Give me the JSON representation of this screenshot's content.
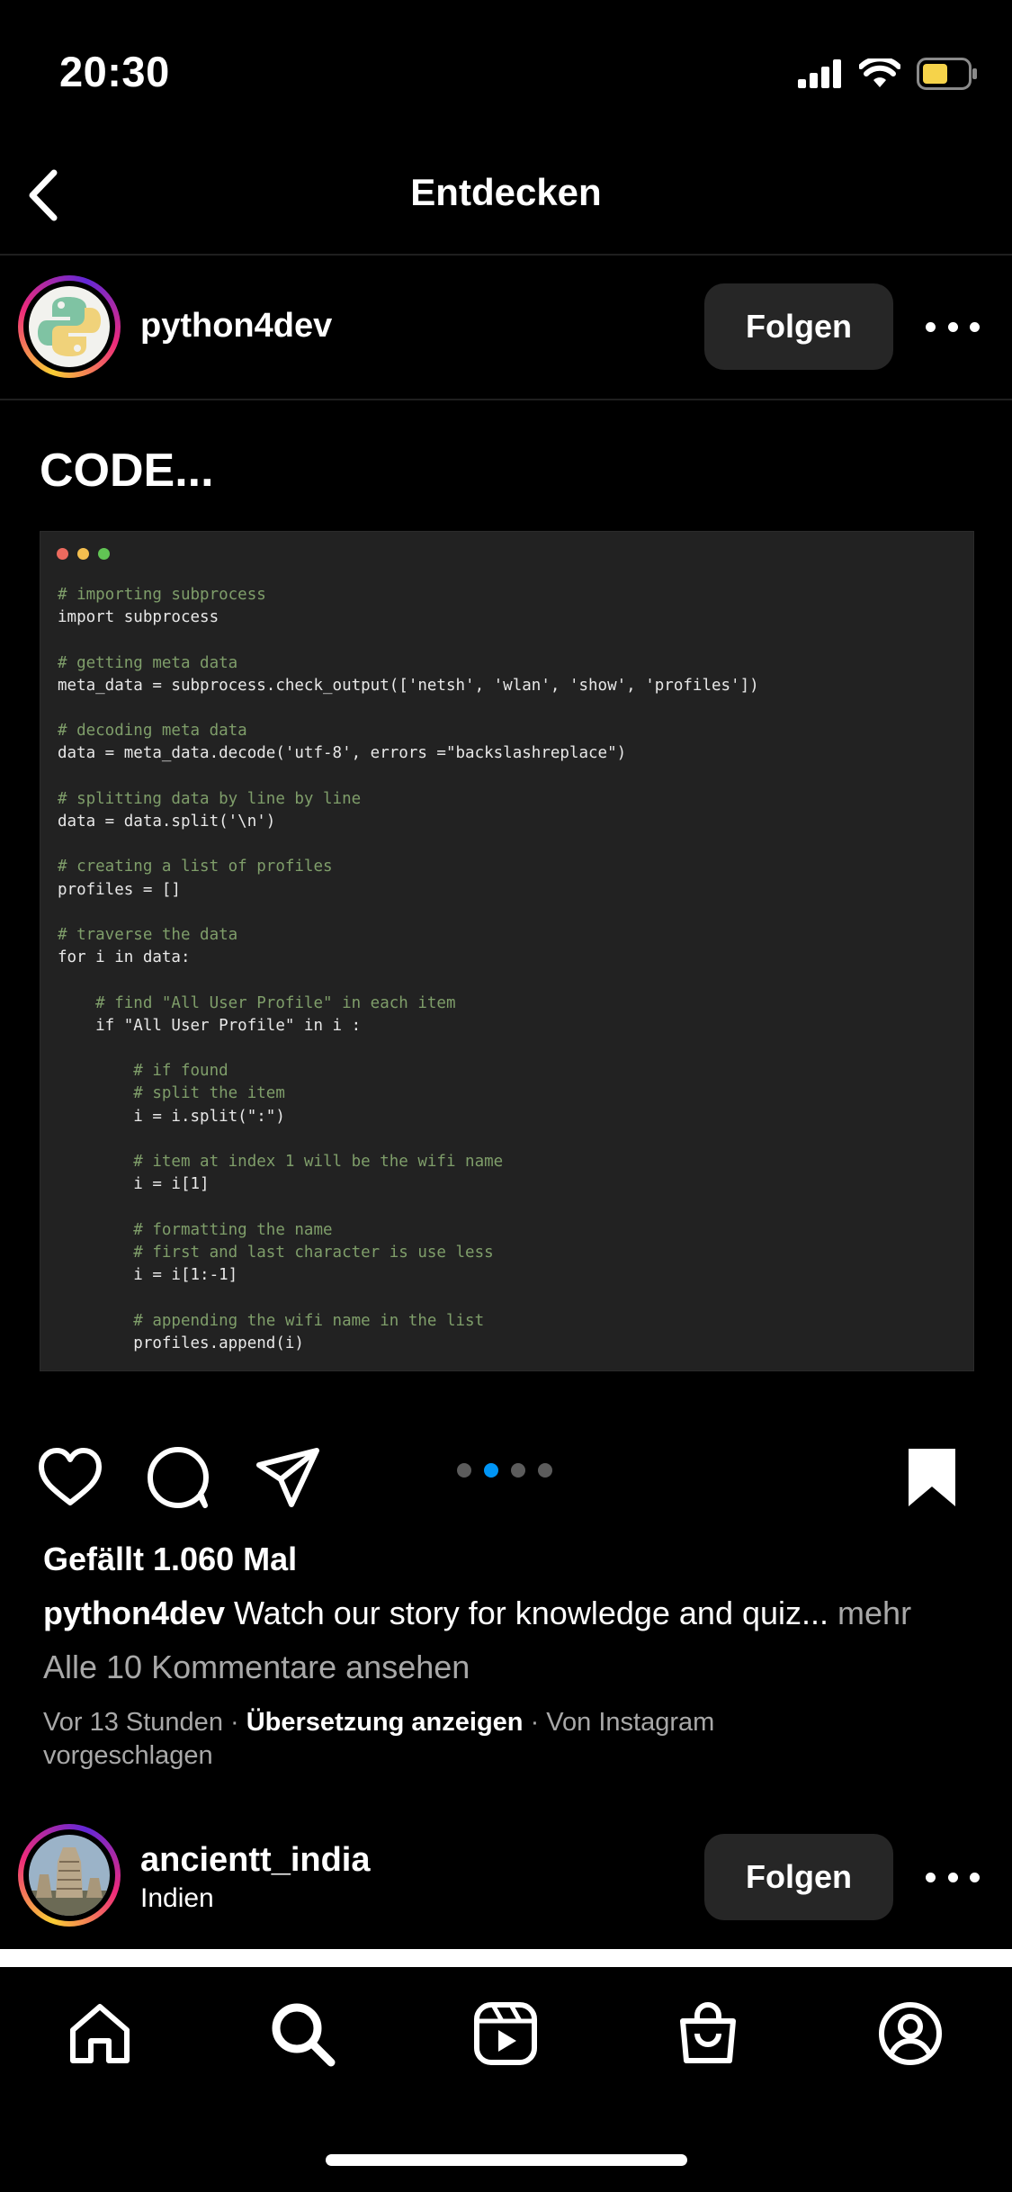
{
  "status_bar": {
    "time": "20:30"
  },
  "header": {
    "title": "Entdecken"
  },
  "post": {
    "username": "python4dev",
    "follow_label": "Folgen",
    "heading": "CODE...",
    "code_lines": [
      "# importing subprocess",
      "import subprocess",
      "",
      "# getting meta data",
      "meta_data = subprocess.check_output(['netsh', 'wlan', 'show', 'profiles'])",
      "",
      "# decoding meta data",
      "data = meta_data.decode('utf-8', errors =\"backslashreplace\")",
      "",
      "# splitting data by line by line",
      "data = data.split('\\n')",
      "",
      "# creating a list of profiles",
      "profiles = []",
      "",
      "# traverse the data",
      "for i in data:",
      "",
      "    # find \"All User Profile\" in each item",
      "    if \"All User Profile\" in i :",
      "",
      "        # if found",
      "        # split the item",
      "        i = i.split(\":\")",
      "",
      "        # item at index 1 will be the wifi name",
      "        i = i[1]",
      "",
      "        # formatting the name",
      "        # first and last character is use less",
      "        i = i[1:-1]",
      "",
      "        # appending the wifi name in the list",
      "        profiles.append(i)"
    ],
    "carousel": {
      "total": 4,
      "active_index": 1
    },
    "likes": "Gefällt 1.060 Mal",
    "caption_user": "python4dev",
    "caption_text": " Watch our story for knowledge and quiz...",
    "caption_more": " mehr",
    "comments_link": "Alle 10 Kommentare ansehen",
    "time_ago": "Vor 13 Stunden",
    "translate": "Übersetzung anzeigen",
    "suggested_line1": "Von Instagram",
    "suggested_line2": "vorgeschlagen"
  },
  "next_post": {
    "username": "ancientt_india",
    "location": "Indien",
    "follow_label": "Folgen"
  },
  "bottom_nav": [
    "home-icon",
    "search-icon",
    "reels-icon",
    "shop-icon",
    "profile-icon"
  ],
  "colors": {
    "accent": "#0095f6",
    "button_bg": "#262626",
    "muted_text": "#a8a8a8"
  }
}
